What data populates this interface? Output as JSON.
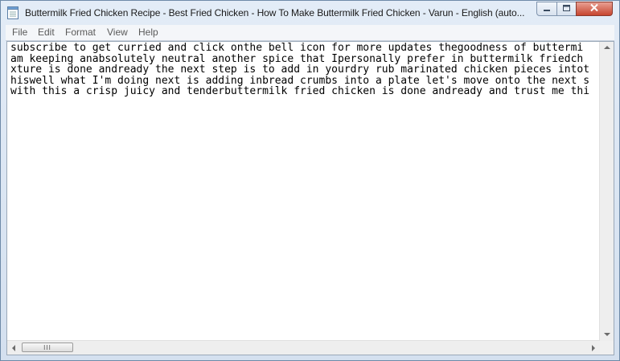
{
  "window": {
    "title": "Buttermilk Fried Chicken Recipe - Best Fried Chicken - How To Make Buttermilk Fried Chicken - Varun - English (auto..."
  },
  "menu": [
    {
      "label": "File"
    },
    {
      "label": "Edit"
    },
    {
      "label": "Format"
    },
    {
      "label": "View"
    },
    {
      "label": "Help"
    }
  ],
  "document": {
    "lines": [
      "subscribe to get curried and click onthe bell icon for more updates thegoodness of buttermi",
      "am keeping anabsolutely neutral another spice that Ipersonally prefer in buttermilk friedch",
      "xture is done andready the next step is to add in yourdry rub marinated chicken pieces intot",
      "hiswell what I'm doing next is adding inbread crumbs into a plate let's move onto the next s",
      "with this a crisp juicy and tenderbuttermilk fried chicken is done andready and trust me thi"
    ]
  },
  "scrollbar": {
    "thumb_glyph": "III"
  },
  "icons": {
    "app": "notepad-icon",
    "minimize": "minimize-icon",
    "maximize": "maximize-icon",
    "close": "close-icon"
  }
}
